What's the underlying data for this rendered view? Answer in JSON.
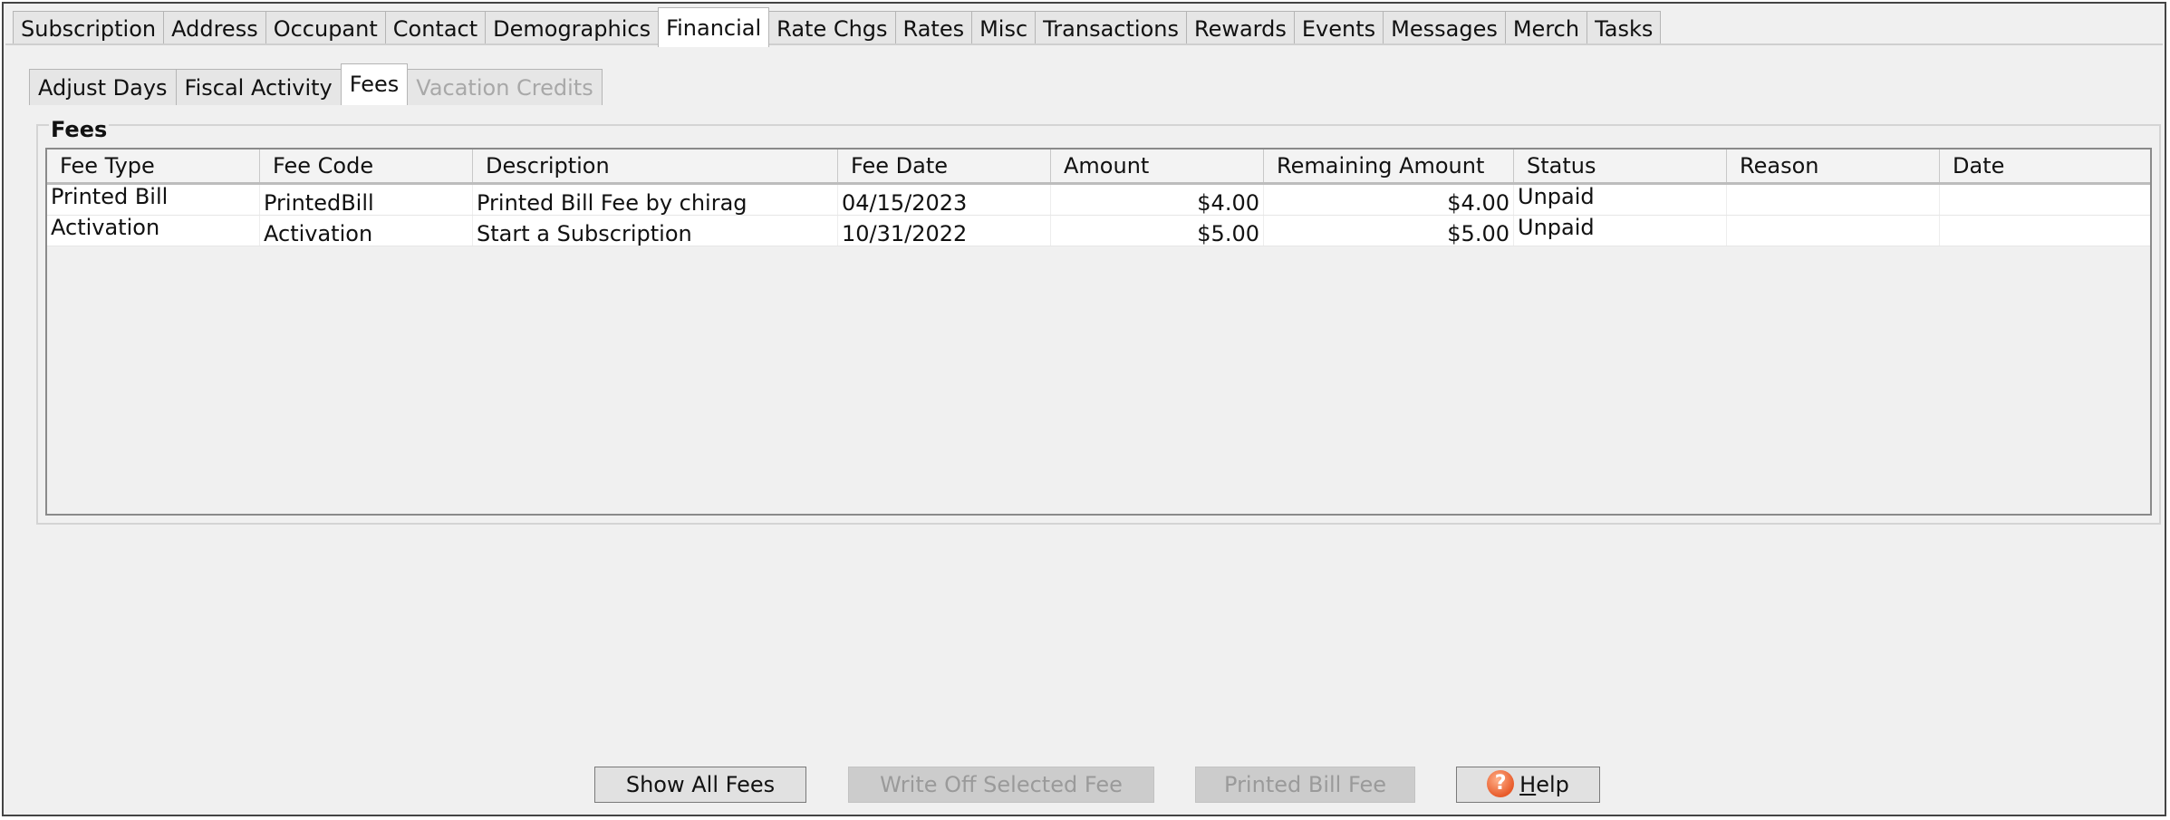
{
  "main_tabs": [
    {
      "label": "Subscription",
      "active": false
    },
    {
      "label": "Address",
      "active": false
    },
    {
      "label": "Occupant",
      "active": false
    },
    {
      "label": "Contact",
      "active": false
    },
    {
      "label": "Demographics",
      "active": false
    },
    {
      "label": "Financial",
      "active": true
    },
    {
      "label": "Rate Chgs",
      "active": false
    },
    {
      "label": "Rates",
      "active": false
    },
    {
      "label": "Misc",
      "active": false
    },
    {
      "label": "Transactions",
      "active": false
    },
    {
      "label": "Rewards",
      "active": false
    },
    {
      "label": "Events",
      "active": false
    },
    {
      "label": "Messages",
      "active": false
    },
    {
      "label": "Merch",
      "active": false
    },
    {
      "label": "Tasks",
      "active": false
    }
  ],
  "sub_tabs": [
    {
      "label": "Adjust Days",
      "state": "normal"
    },
    {
      "label": "Fiscal Activity",
      "state": "normal"
    },
    {
      "label": "Fees",
      "state": "active"
    },
    {
      "label": "Vacation Credits",
      "state": "disabled"
    }
  ],
  "fees": {
    "group_title": "Fees",
    "columns": [
      "Fee Type",
      "Fee Code",
      "Description",
      "Fee Date",
      "Amount",
      "Remaining Amount",
      "Status",
      "Reason",
      "Date"
    ],
    "rows": [
      [
        "Printed Bill",
        "PrintedBill",
        "Printed Bill Fee by chirag",
        "04/15/2023",
        "$4.00",
        "$4.00",
        "Unpaid",
        "",
        ""
      ],
      [
        "Activation",
        "Activation",
        "Start a Subscription",
        "10/31/2022",
        "$5.00",
        "$5.00",
        "Unpaid",
        "",
        ""
      ]
    ]
  },
  "buttons": {
    "show_all_fees": "Show All Fees",
    "write_off_selected_fee": "Write Off Selected Fee",
    "printed_bill_fee": "Printed Bill Fee",
    "help_mnemonic": "H",
    "help_rest": "elp",
    "help_icon_glyph": "?"
  },
  "colors": {
    "window_bg": "#f0f0f0",
    "disabled_text": "#a8a8a8",
    "help_icon": "#e85b2a"
  }
}
